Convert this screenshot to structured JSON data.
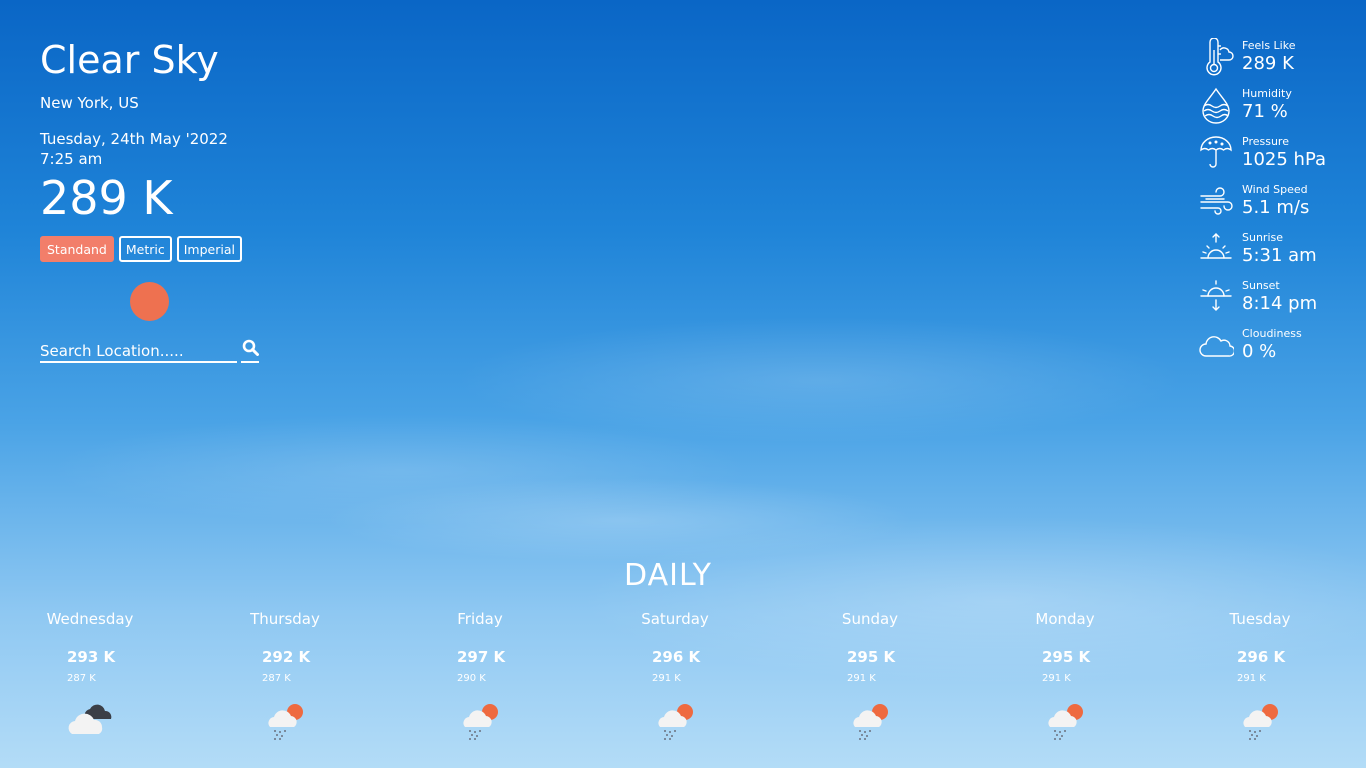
{
  "current": {
    "title": "Clear Sky",
    "location": "New York, US",
    "date": "Tuesday, 24th May '2022",
    "time": "7:25 am",
    "temp": "289 K"
  },
  "units": [
    {
      "label": "Standand",
      "active": true
    },
    {
      "label": "Metric",
      "active": false
    },
    {
      "label": "Imperial",
      "active": false
    }
  ],
  "search": {
    "placeholder": "Search Location....."
  },
  "stats": [
    {
      "label": "Feels Like",
      "value": "289 K",
      "icon": "thermometer-icon"
    },
    {
      "label": "Humidity",
      "value": "71 %",
      "icon": "humidity-drop-icon"
    },
    {
      "label": "Pressure",
      "value": "1025 hPa",
      "icon": "umbrella-icon"
    },
    {
      "label": "Wind Speed",
      "value": "5.1 m/s",
      "icon": "wind-icon"
    },
    {
      "label": "Sunrise",
      "value": "5:31 am",
      "icon": "sunrise-icon"
    },
    {
      "label": "Sunset",
      "value": "8:14 pm",
      "icon": "sunset-icon"
    },
    {
      "label": "Cloudiness",
      "value": "0 %",
      "icon": "cloud-icon"
    }
  ],
  "daily": {
    "title": "DAILY",
    "days": [
      {
        "name": "Wednesday",
        "max": "293 K",
        "min": "287 K",
        "icon": "cloudy-dark-icon"
      },
      {
        "name": "Thursday",
        "max": "292 K",
        "min": "287 K",
        "icon": "sun-cloud-rain-icon"
      },
      {
        "name": "Friday",
        "max": "297 K",
        "min": "290 K",
        "icon": "sun-cloud-rain-icon"
      },
      {
        "name": "Saturday",
        "max": "296 K",
        "min": "291 K",
        "icon": "sun-cloud-rain-icon"
      },
      {
        "name": "Sunday",
        "max": "295 K",
        "min": "291 K",
        "icon": "sun-cloud-rain-icon"
      },
      {
        "name": "Monday",
        "max": "295 K",
        "min": "291 K",
        "icon": "sun-cloud-rain-icon"
      },
      {
        "name": "Tuesday",
        "max": "296 K",
        "min": "291 K",
        "icon": "sun-cloud-rain-icon"
      }
    ]
  }
}
